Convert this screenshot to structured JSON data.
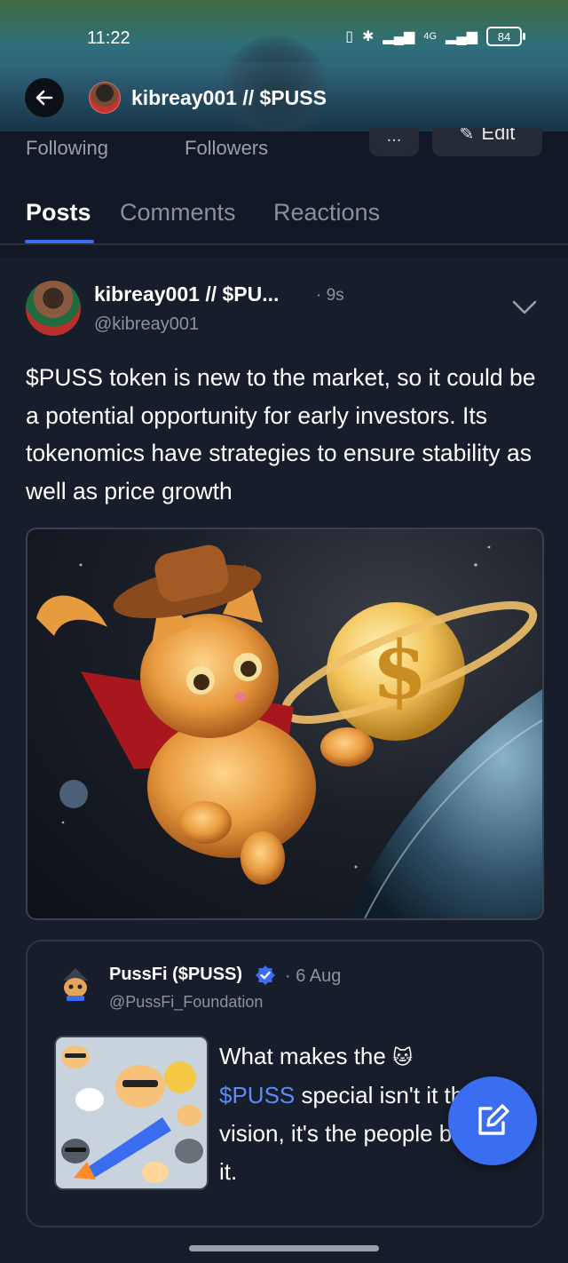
{
  "status_bar": {
    "time": "11:22",
    "network": "4G",
    "battery": "84"
  },
  "header": {
    "title": "kibreay001 // $PUSS"
  },
  "profile": {
    "following_label": "Following",
    "followers_label": "Followers",
    "more_label": "...",
    "edit_label": "Edit"
  },
  "tabs": [
    {
      "label": "Posts",
      "active": true
    },
    {
      "label": "Comments",
      "active": false
    },
    {
      "label": "Reactions",
      "active": false
    }
  ],
  "post": {
    "author": "kibreay001 // $PU...",
    "time": "· 9s",
    "handle": "@kibreay001",
    "text": "$PUSS token is new to the market, so it could be a potential opportunity for early investors. Its tokenomics have strategies to ensure stability as well as price growth",
    "quote": {
      "author": "PussFi ($PUSS)",
      "date": "· 6 Aug",
      "handle": "@PussFi_Foundation",
      "text_pre": "What makes the ",
      "text_highlight": "$PUSS",
      "text_post": " special isn't it the vision, it's the people behind it."
    }
  },
  "colors": {
    "accent": "#3a6df0",
    "background": "#121826",
    "card": "#171d2a",
    "muted": "#8d939e"
  },
  "icons": {
    "back": "arrow-left-icon",
    "options": "chevron-down-icon",
    "verified": "verified-badge-icon",
    "compose": "compose-icon"
  }
}
